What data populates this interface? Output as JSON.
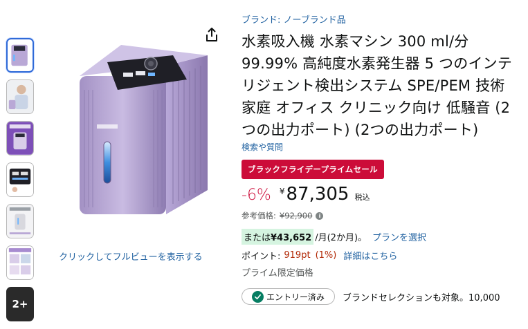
{
  "gallery": {
    "thumbnails": [
      {
        "name": "device-front",
        "active": true
      },
      {
        "name": "person-using"
      },
      {
        "name": "infographic-purple"
      },
      {
        "name": "touch-panel"
      },
      {
        "name": "features-list"
      },
      {
        "name": "usage-scenes"
      }
    ],
    "more_label": "2+",
    "full_view_label": "クリックしてフルビューを表示する"
  },
  "product": {
    "brand_link": "ブランド: ノーブランド品",
    "title": "水素吸入機 水素マシン 300 ml/分 99.99% 高純度水素発生器 5 つのインテリジェント検出システム SPE/PEM 技術 家庭 オフィス クリニック向け 低騒音 (2つの出力ポート) (2つの出力ポート)",
    "qa_link": "検索や質問"
  },
  "deal": {
    "badge": "ブラックフライデープライムセール",
    "color": "#cc0c39"
  },
  "price": {
    "discount": "-6%",
    "currency": "¥",
    "amount": "87,305",
    "tax_label": "税込",
    "ref_label": "参考価格:",
    "ref_price": "¥92,900",
    "info_icon": "i"
  },
  "installment": {
    "prefix": "または",
    "amount": "¥43,652",
    "suffix": "/月(2か月)。",
    "plan_link": "プランを選択"
  },
  "points": {
    "label": "ポイント:",
    "value": "919pt",
    "percent": "(1%)",
    "detail_link": "詳細はこちら"
  },
  "prime_limited": "プライム限定価格",
  "entry": {
    "badge_label": "エントリー済み",
    "check_icon": "check-circle-icon",
    "brand_selection": "ブランドセレクションも対象。10,000"
  },
  "colors": {
    "link": "#2162a1",
    "accent_red": "#cc0c39",
    "device": "#b9a8d6"
  }
}
